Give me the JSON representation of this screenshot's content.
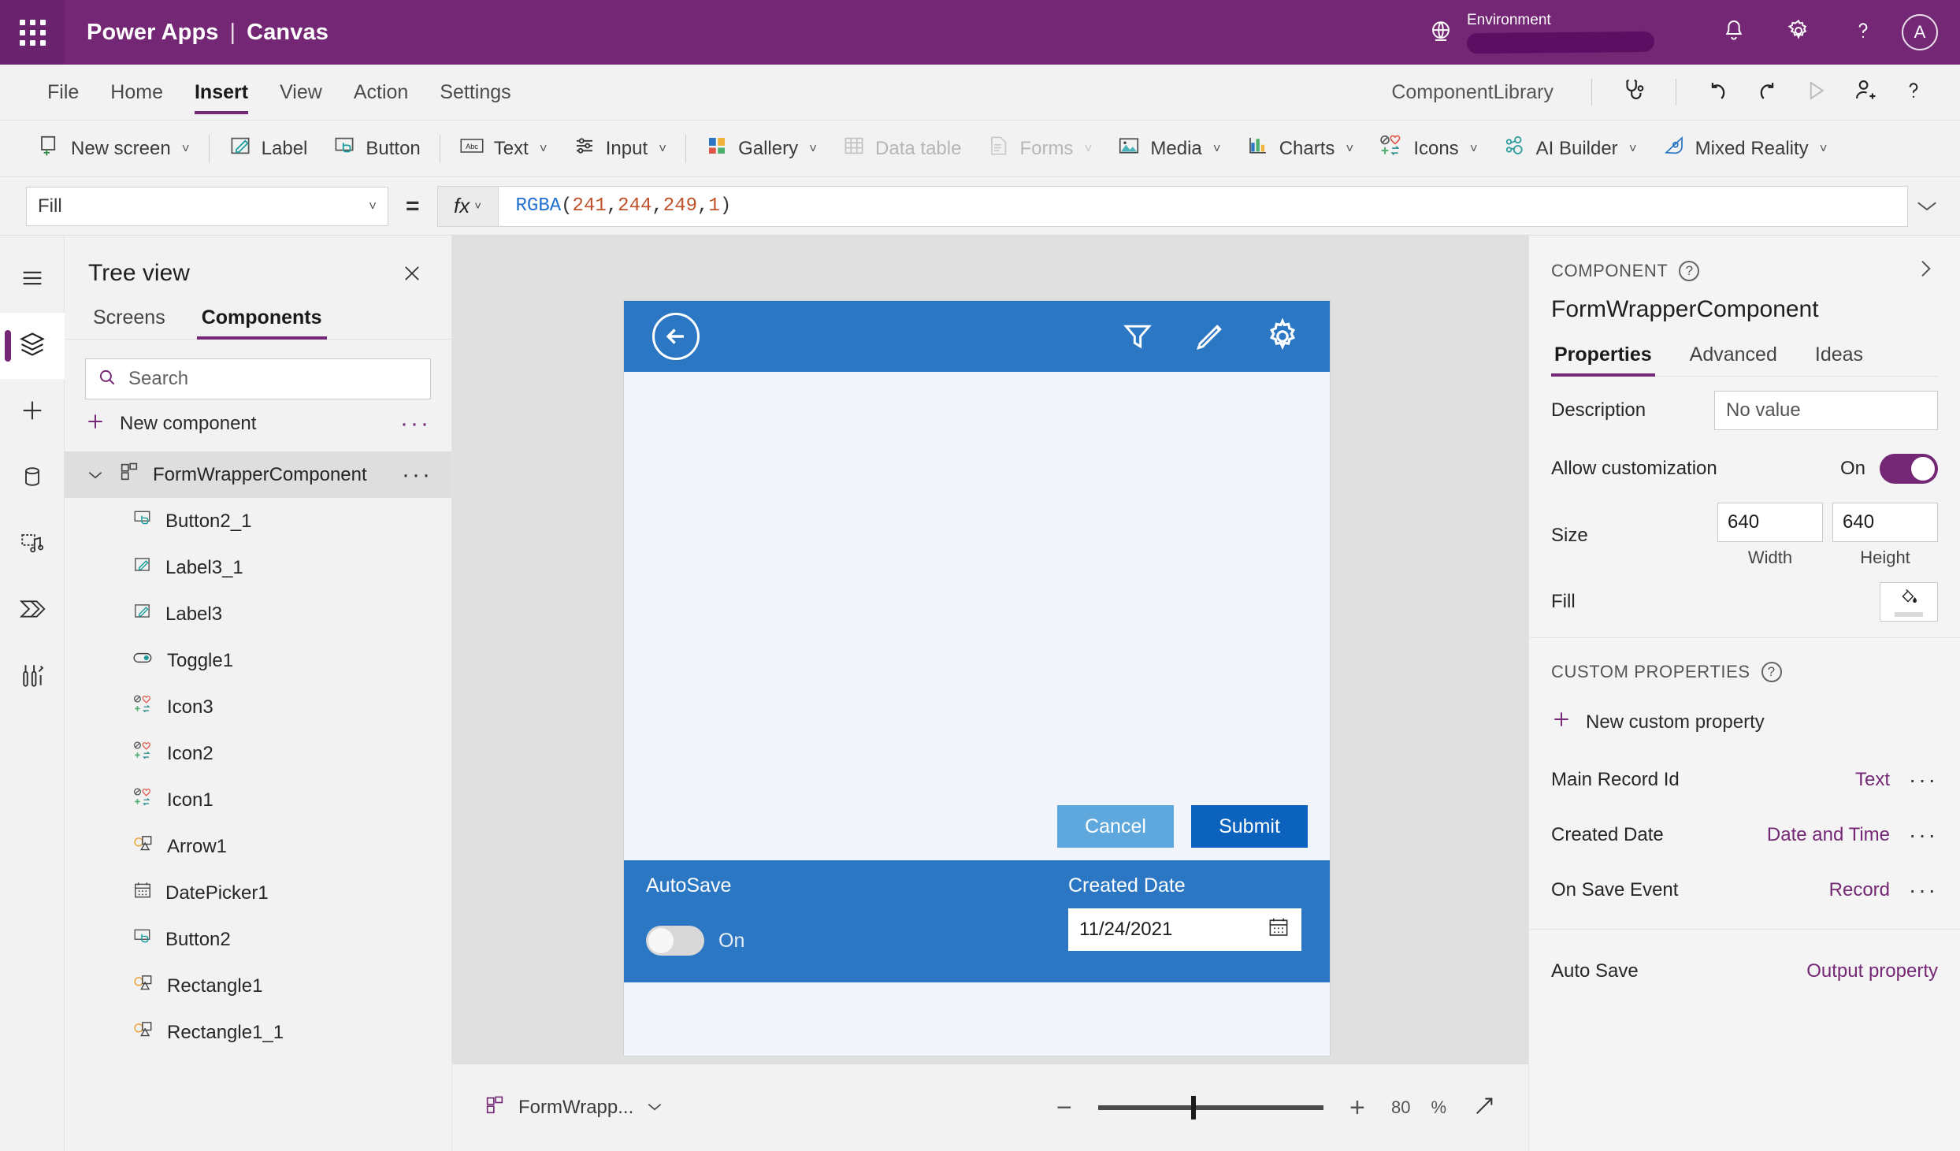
{
  "topbar": {
    "waffle_icon": "waffle-grid-icon",
    "brand_primary": "Power Apps",
    "brand_separator": "|",
    "brand_secondary": "Canvas",
    "environment_label": "Environment",
    "globe_icon": "globe-icon",
    "bell_icon": "bell-icon",
    "gear_icon": "gear-icon",
    "help_icon": "question-mark-icon",
    "avatar_initial": "A"
  },
  "menubar": {
    "items": [
      {
        "label": "File",
        "active": false
      },
      {
        "label": "Home",
        "active": false
      },
      {
        "label": "Insert",
        "active": true
      },
      {
        "label": "View",
        "active": false
      },
      {
        "label": "Action",
        "active": false
      },
      {
        "label": "Settings",
        "active": false
      }
    ],
    "app_name": "ComponentLibrary",
    "right_icons": [
      "stethoscope-icon",
      "undo-icon",
      "redo-icon",
      "play-icon",
      "add-user-icon",
      "question-mark-icon"
    ]
  },
  "ribbon": {
    "items": [
      {
        "label": "New screen",
        "icon": "new-screen-icon",
        "chevron": true,
        "disabled": false
      },
      {
        "label": "Label",
        "icon": "label-icon",
        "chevron": false,
        "disabled": false
      },
      {
        "label": "Button",
        "icon": "button-icon",
        "chevron": false,
        "disabled": false
      },
      {
        "label": "Text",
        "icon": "text-abc-icon",
        "chevron": true,
        "disabled": false
      },
      {
        "label": "Input",
        "icon": "input-sliders-icon",
        "chevron": true,
        "disabled": false
      },
      {
        "label": "Gallery",
        "icon": "gallery-icon",
        "chevron": true,
        "disabled": false
      },
      {
        "label": "Data table",
        "icon": "data-table-icon",
        "chevron": false,
        "disabled": true
      },
      {
        "label": "Forms",
        "icon": "forms-icon",
        "chevron": true,
        "disabled": true
      },
      {
        "label": "Media",
        "icon": "media-image-icon",
        "chevron": true,
        "disabled": false
      },
      {
        "label": "Charts",
        "icon": "charts-bar-icon",
        "chevron": true,
        "disabled": false
      },
      {
        "label": "Icons",
        "icon": "icons-shapes-icon",
        "chevron": true,
        "disabled": false
      },
      {
        "label": "AI Builder",
        "icon": "ai-builder-icon",
        "chevron": true,
        "disabled": false
      },
      {
        "label": "Mixed Reality",
        "icon": "mixed-reality-icon",
        "chevron": true,
        "disabled": false
      }
    ]
  },
  "formula_bar": {
    "property": "Fill",
    "equals": "=",
    "fx_label": "fx",
    "formula_tokens": [
      {
        "text": "RGBA",
        "kind": "fn"
      },
      {
        "text": "(",
        "kind": "pn"
      },
      {
        "text": "241",
        "kind": "num"
      },
      {
        "text": ", ",
        "kind": "pn"
      },
      {
        "text": "244",
        "kind": "num"
      },
      {
        "text": ", ",
        "kind": "pn"
      },
      {
        "text": "249",
        "kind": "num"
      },
      {
        "text": ", ",
        "kind": "pn"
      },
      {
        "text": "1",
        "kind": "num"
      },
      {
        "text": ")",
        "kind": "pn"
      }
    ],
    "formula_text": "RGBA(241, 244, 249, 1)"
  },
  "rail": {
    "items": [
      {
        "name": "hamburger-menu-icon",
        "active": false
      },
      {
        "name": "tree-view-layers-icon",
        "active": true
      },
      {
        "name": "insert-plus-icon",
        "active": false
      },
      {
        "name": "data-cylinder-icon",
        "active": false
      },
      {
        "name": "media-icon",
        "active": false
      },
      {
        "name": "power-automate-icon",
        "active": false
      },
      {
        "name": "variables-tools-icon",
        "active": false
      }
    ]
  },
  "treeview": {
    "title": "Tree view",
    "close_icon": "close-icon",
    "tabs": [
      {
        "label": "Screens",
        "active": false
      },
      {
        "label": "Components",
        "active": true
      }
    ],
    "search_placeholder": "Search",
    "search_value": "",
    "search_icon": "search-icon",
    "new_component_label": "New component",
    "new_component_icon": "plus-icon",
    "overflow_label": "···",
    "root": {
      "label": "FormWrapperComponent",
      "icon": "component-icon",
      "expanded": true,
      "selected": true
    },
    "children": [
      {
        "label": "Button2_1",
        "icon": "button-icon"
      },
      {
        "label": "Label3_1",
        "icon": "label-icon"
      },
      {
        "label": "Label3",
        "icon": "label-icon"
      },
      {
        "label": "Toggle1",
        "icon": "toggle-icon"
      },
      {
        "label": "Icon3",
        "icon": "icons-shapes-icon"
      },
      {
        "label": "Icon2",
        "icon": "icons-shapes-icon"
      },
      {
        "label": "Icon1",
        "icon": "icons-shapes-icon"
      },
      {
        "label": "Arrow1",
        "icon": "shapes-icon"
      },
      {
        "label": "DatePicker1",
        "icon": "calendar-icon"
      },
      {
        "label": "Button2",
        "icon": "button-icon"
      },
      {
        "label": "Rectangle1",
        "icon": "shapes-icon"
      },
      {
        "label": "Rectangle1_1",
        "icon": "shapes-icon"
      }
    ]
  },
  "canvas": {
    "header": {
      "back_icon": "back-arrow-circle-icon",
      "filter_icon": "filter-funnel-icon",
      "edit_icon": "pencil-edit-icon",
      "settings_icon": "gear-icon"
    },
    "cancel_button": "Cancel",
    "submit_button": "Submit",
    "footer": {
      "autosave_label": "AutoSave",
      "autosave_state": "On",
      "created_date_label": "Created Date",
      "created_date_value": "11/24/2021",
      "calendar_icon": "calendar-icon"
    }
  },
  "properties_panel": {
    "kicker": "COMPONENT",
    "help_icon": "question-mark-icon",
    "collapse_icon": "chevron-right-icon",
    "title": "FormWrapperComponent",
    "tabs": [
      {
        "label": "Properties",
        "active": true
      },
      {
        "label": "Advanced",
        "active": false
      },
      {
        "label": "Ideas",
        "active": false
      }
    ],
    "description_label": "Description",
    "description_value": "No value",
    "allow_customization_label": "Allow customization",
    "allow_customization_state": "On",
    "size_label": "Size",
    "width_value": "640",
    "height_value": "640",
    "width_caption": "Width",
    "height_caption": "Height",
    "fill_label": "Fill",
    "fill_icon": "paint-bucket-icon",
    "custom_kicker": "CUSTOM PROPERTIES",
    "new_custom_property": "New custom property",
    "custom_properties": [
      {
        "name": "Main Record Id",
        "type": "Text",
        "overflow": "···"
      },
      {
        "name": "Created Date",
        "type": "Date and Time",
        "overflow": "···"
      },
      {
        "name": "On Save Event",
        "type": "Record",
        "overflow": "···"
      }
    ],
    "output_properties": [
      {
        "name": "Auto Save",
        "type": "Output property"
      }
    ]
  },
  "statusbar": {
    "component_label": "FormWrapp...",
    "component_icon": "component-icon",
    "chevron_icon": "chevron-down-icon",
    "zoom_out_icon": "minus-icon",
    "zoom_in_icon": "plus-icon",
    "zoom_value": "80",
    "zoom_unit": "%",
    "fullscreen_icon": "expand-diagonal-icon"
  },
  "colors": {
    "brand_purple": "#742774",
    "accent_blue": "#2b77c4",
    "submit_blue": "#0b63bd",
    "cancel_blue": "#5fa8de",
    "canvas_fill": "#f1f4f9"
  }
}
